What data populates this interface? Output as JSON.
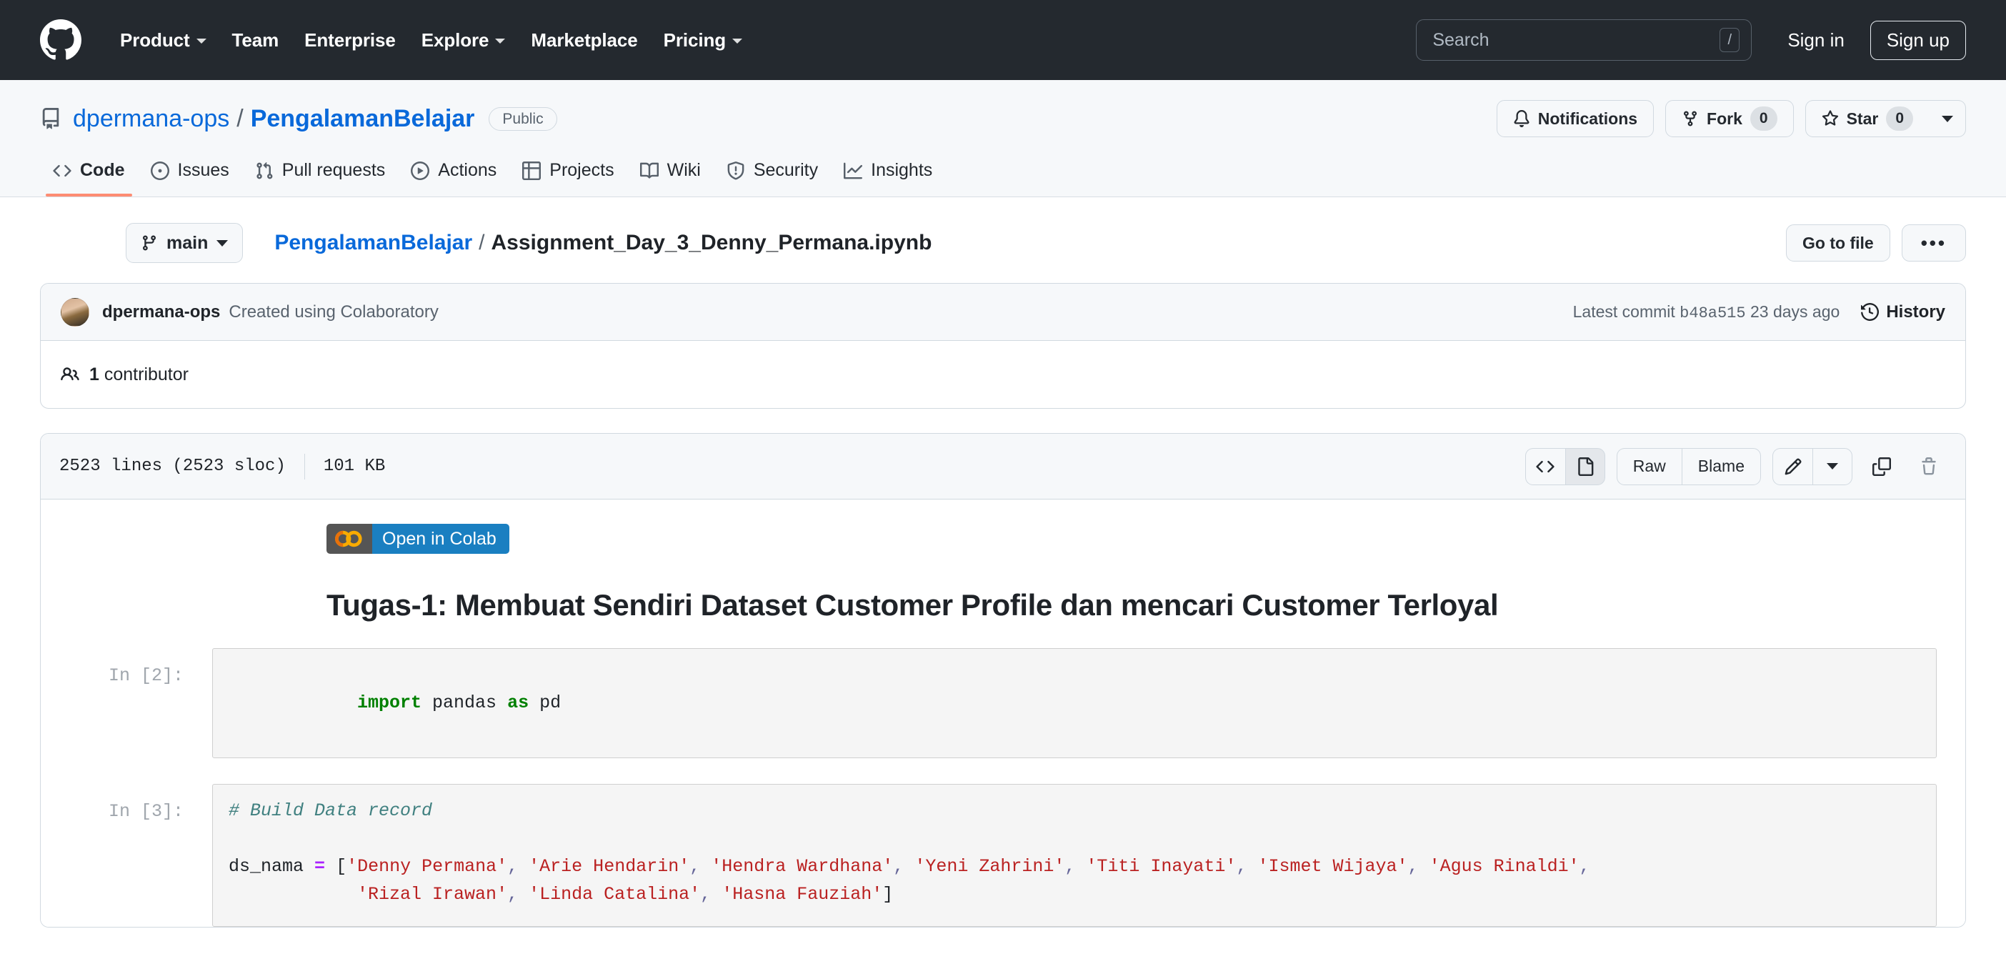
{
  "header": {
    "logo_icon": "github-mark-icon",
    "nav": [
      {
        "label": "Product",
        "has_caret": true
      },
      {
        "label": "Team",
        "has_caret": false
      },
      {
        "label": "Enterprise",
        "has_caret": false
      },
      {
        "label": "Explore",
        "has_caret": true
      },
      {
        "label": "Marketplace",
        "has_caret": false
      },
      {
        "label": "Pricing",
        "has_caret": true
      }
    ],
    "search_placeholder": "Search",
    "search_shortcut": "/",
    "sign_in": "Sign in",
    "sign_up": "Sign up",
    "bg_color": "#24292f"
  },
  "repo": {
    "owner": "dpermana-ops",
    "separator": "/",
    "name": "PengalamanBelajar",
    "visibility": "Public",
    "actions": {
      "notifications": "Notifications",
      "fork": "Fork",
      "fork_count": "0",
      "star": "Star",
      "star_count": "0"
    },
    "tabs": [
      {
        "label": "Code",
        "icon": "code-icon",
        "active": true
      },
      {
        "label": "Issues",
        "icon": "issue-opened-icon",
        "active": false
      },
      {
        "label": "Pull requests",
        "icon": "git-pull-request-icon",
        "active": false
      },
      {
        "label": "Actions",
        "icon": "play-icon",
        "active": false
      },
      {
        "label": "Projects",
        "icon": "table-icon",
        "active": false
      },
      {
        "label": "Wiki",
        "icon": "book-icon",
        "active": false
      },
      {
        "label": "Security",
        "icon": "shield-icon",
        "active": false
      },
      {
        "label": "Insights",
        "icon": "graph-icon",
        "active": false
      }
    ],
    "accent_color": "#fd8c73",
    "link_color": "#0969da"
  },
  "filenav": {
    "branch": "main",
    "breadcrumb_repo": "PengalamanBelajar",
    "breadcrumb_sep": "/",
    "breadcrumb_file": "Assignment_Day_3_Denny_Permana.ipynb",
    "go_to_file": "Go to file",
    "more_menu": "•••"
  },
  "commit": {
    "author": "dpermana-ops",
    "message": "Created using Colaboratory",
    "latest_commit_label": "Latest commit",
    "sha": "b48a515",
    "relative_time": "23 days ago",
    "history": "History",
    "contributors_count": "1",
    "contributors_label": "contributor"
  },
  "blob": {
    "lines": "2523 lines (2523 sloc)",
    "size": "101 KB",
    "raw": "Raw",
    "blame": "Blame",
    "view_code_icon": "code-icon",
    "view_preview_icon": "file-icon",
    "edit_icon": "pencil-icon",
    "copy_icon": "copy-icon",
    "delete_icon": "trash-icon"
  },
  "notebook": {
    "colab_badge": "Open in Colab",
    "title": "Tugas-1: Membuat Sendiri Dataset Customer Profile dan mencari Customer Terloyal",
    "cells": [
      {
        "prompt": "In [2]:",
        "lines": [
          [
            {
              "t": "import",
              "c": "tok-kw"
            },
            {
              "t": " pandas ",
              "c": ""
            },
            {
              "t": "as",
              "c": "tok-kw"
            },
            {
              "t": " pd",
              "c": ""
            }
          ]
        ]
      },
      {
        "prompt": "In [3]:",
        "lines": [
          [
            {
              "t": "# Build Data record",
              "c": "tok-cm"
            }
          ],
          [
            {
              "t": "",
              "c": ""
            }
          ],
          [
            {
              "t": "ds_nama ",
              "c": ""
            },
            {
              "t": "=",
              "c": "tok-op"
            },
            {
              "t": " [",
              "c": "tok-punct"
            },
            {
              "t": "'Denny Permana'",
              "c": "tok-str"
            },
            {
              "t": ", ",
              "c": "tok-punct"
            },
            {
              "t": "'Arie Hendarin'",
              "c": "tok-str"
            },
            {
              "t": ", ",
              "c": "tok-punct"
            },
            {
              "t": "'Hendra Wardhana'",
              "c": "tok-str"
            },
            {
              "t": ", ",
              "c": "tok-punct"
            },
            {
              "t": "'Yeni Zahrini'",
              "c": "tok-str"
            },
            {
              "t": ", ",
              "c": "tok-punct"
            },
            {
              "t": "'Titi Inayati'",
              "c": "tok-str"
            },
            {
              "t": ", ",
              "c": "tok-punct"
            },
            {
              "t": "'Ismet Wijaya'",
              "c": "tok-str"
            },
            {
              "t": ", ",
              "c": "tok-punct"
            },
            {
              "t": "'Agus Rinaldi'",
              "c": "tok-str"
            },
            {
              "t": ",",
              "c": "tok-punct"
            }
          ],
          [
            {
              "t": "            ",
              "c": ""
            },
            {
              "t": "'Rizal Irawan'",
              "c": "tok-str"
            },
            {
              "t": ", ",
              "c": "tok-punct"
            },
            {
              "t": "'Linda Catalina'",
              "c": "tok-str"
            },
            {
              "t": ", ",
              "c": "tok-punct"
            },
            {
              "t": "'Hasna Fauziah'",
              "c": "tok-str"
            },
            {
              "t": "]",
              "c": "tok-punct"
            }
          ]
        ]
      }
    ]
  }
}
